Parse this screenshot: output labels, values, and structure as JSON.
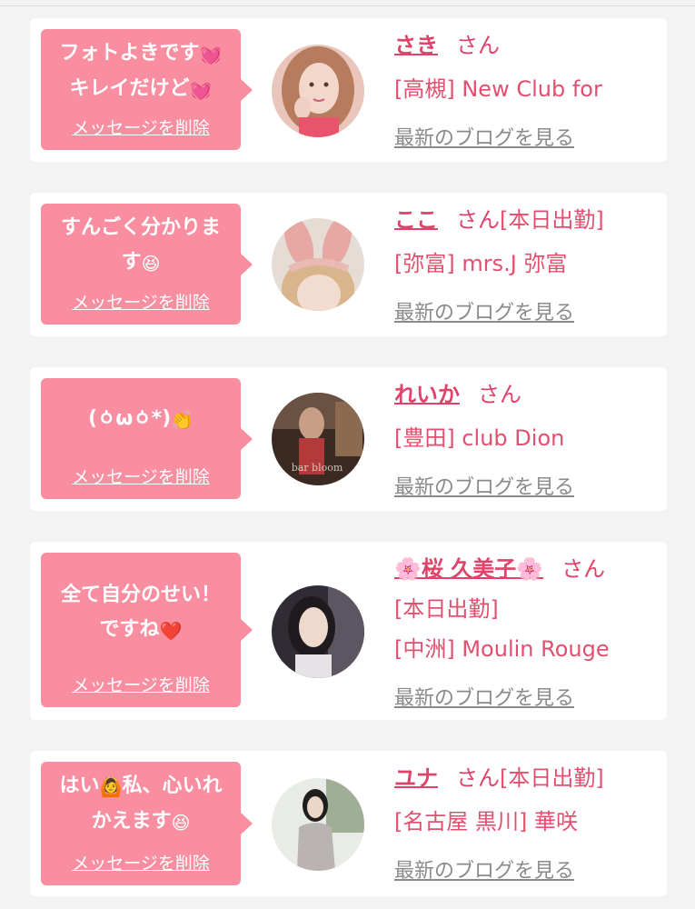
{
  "colors": {
    "accent": "#f98ea0",
    "name": "#e0426a",
    "shop": "#e3506f",
    "blog": "#8a8a8a"
  },
  "cards": [
    {
      "message_lines": [
        "フォトよきです",
        "キレイだけど"
      ],
      "message_emojis": [
        "heart-emoji",
        "heart-emoji"
      ],
      "delete_label": "メッセージを削除",
      "name": "さき",
      "honorific": "さん",
      "status": "",
      "shop": "[高槻] New Club for",
      "blog_label": "最新のブログを見る"
    },
    {
      "message_lines": [
        "すんごく分かりま",
        "す"
      ],
      "message_emojis": [
        "",
        "laughing-emoji"
      ],
      "delete_label": "メッセージを削除",
      "name": "ここ",
      "honorific": "さん",
      "status": "[本日出勤]",
      "shop": "[弥富] mrs.J 弥富",
      "blog_label": "最新のブログを見る"
    },
    {
      "message_lines": [
        "(ㆁωㆁ*)"
      ],
      "message_emojis": [
        "clapping-hands-emoji"
      ],
      "delete_label": "メッセージを削除",
      "name": "れいか",
      "honorific": "さん",
      "status": "",
      "shop": "[豊田] club Dion",
      "blog_label": "最新のブログを見る"
    },
    {
      "message_lines": [
        "全て自分のせい！",
        "ですね"
      ],
      "message_emojis": [
        "",
        "red-heart-emoji"
      ],
      "delete_label": "メッセージを削除",
      "name": "桜 久美子",
      "honorific": "さん",
      "status": "[本日出勤]",
      "shop": "[中洲] Moulin Rouge",
      "blog_label": "最新のブログを見る"
    },
    {
      "message_lines": [
        "はい",
        "私、心いれ",
        "かえます"
      ],
      "message_emojis": [
        "person-gesturing-ok-emoji",
        "",
        "laughing-emoji"
      ],
      "delete_label": "メッセージを削除",
      "name": "ユナ",
      "honorific": "さん",
      "status": "[本日出勤]",
      "shop": "[名古屋 黒川] 華咲",
      "blog_label": "最新のブログを見る"
    }
  ]
}
